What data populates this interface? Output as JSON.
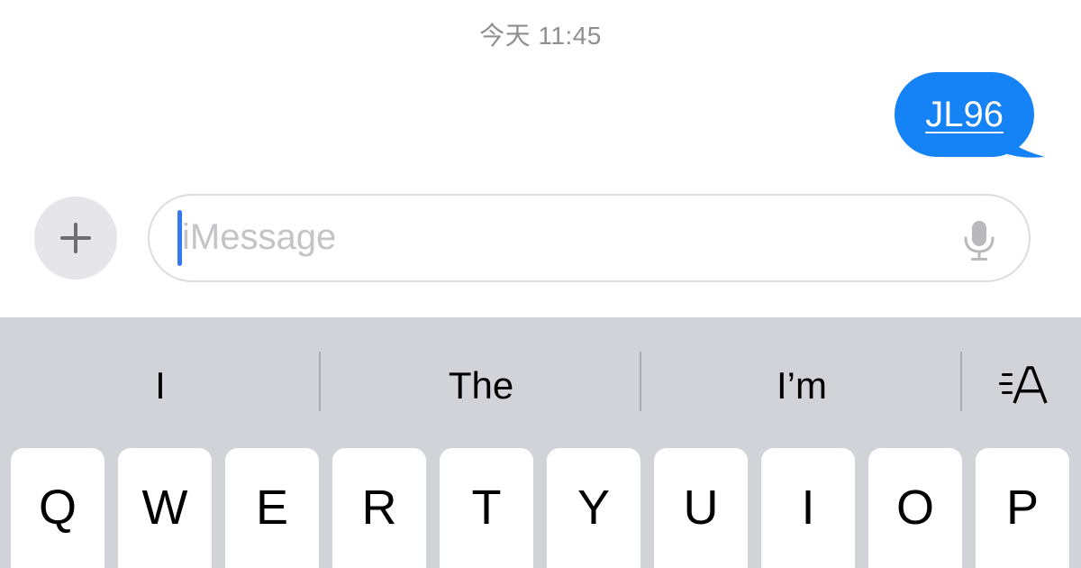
{
  "conversation": {
    "timestamp": "今天 11:45",
    "messages": [
      {
        "direction": "outgoing",
        "text": "JL96",
        "is_link": true
      }
    ]
  },
  "composer": {
    "add_button_icon": "plus-icon",
    "placeholder": "iMessage",
    "value": "",
    "mic_icon": "microphone-icon"
  },
  "keyboard": {
    "suggestions": [
      "I",
      "The",
      "I’m"
    ],
    "predictive_icon": "text-format-icon",
    "top_row_keys": [
      "Q",
      "W",
      "E",
      "R",
      "T",
      "Y",
      "U",
      "I",
      "O",
      "P"
    ]
  },
  "colors": {
    "bubble": "#1582f5",
    "caret": "#3478f6",
    "keyboard_bg": "#d1d3d9",
    "timestamp": "#8e8e93"
  }
}
